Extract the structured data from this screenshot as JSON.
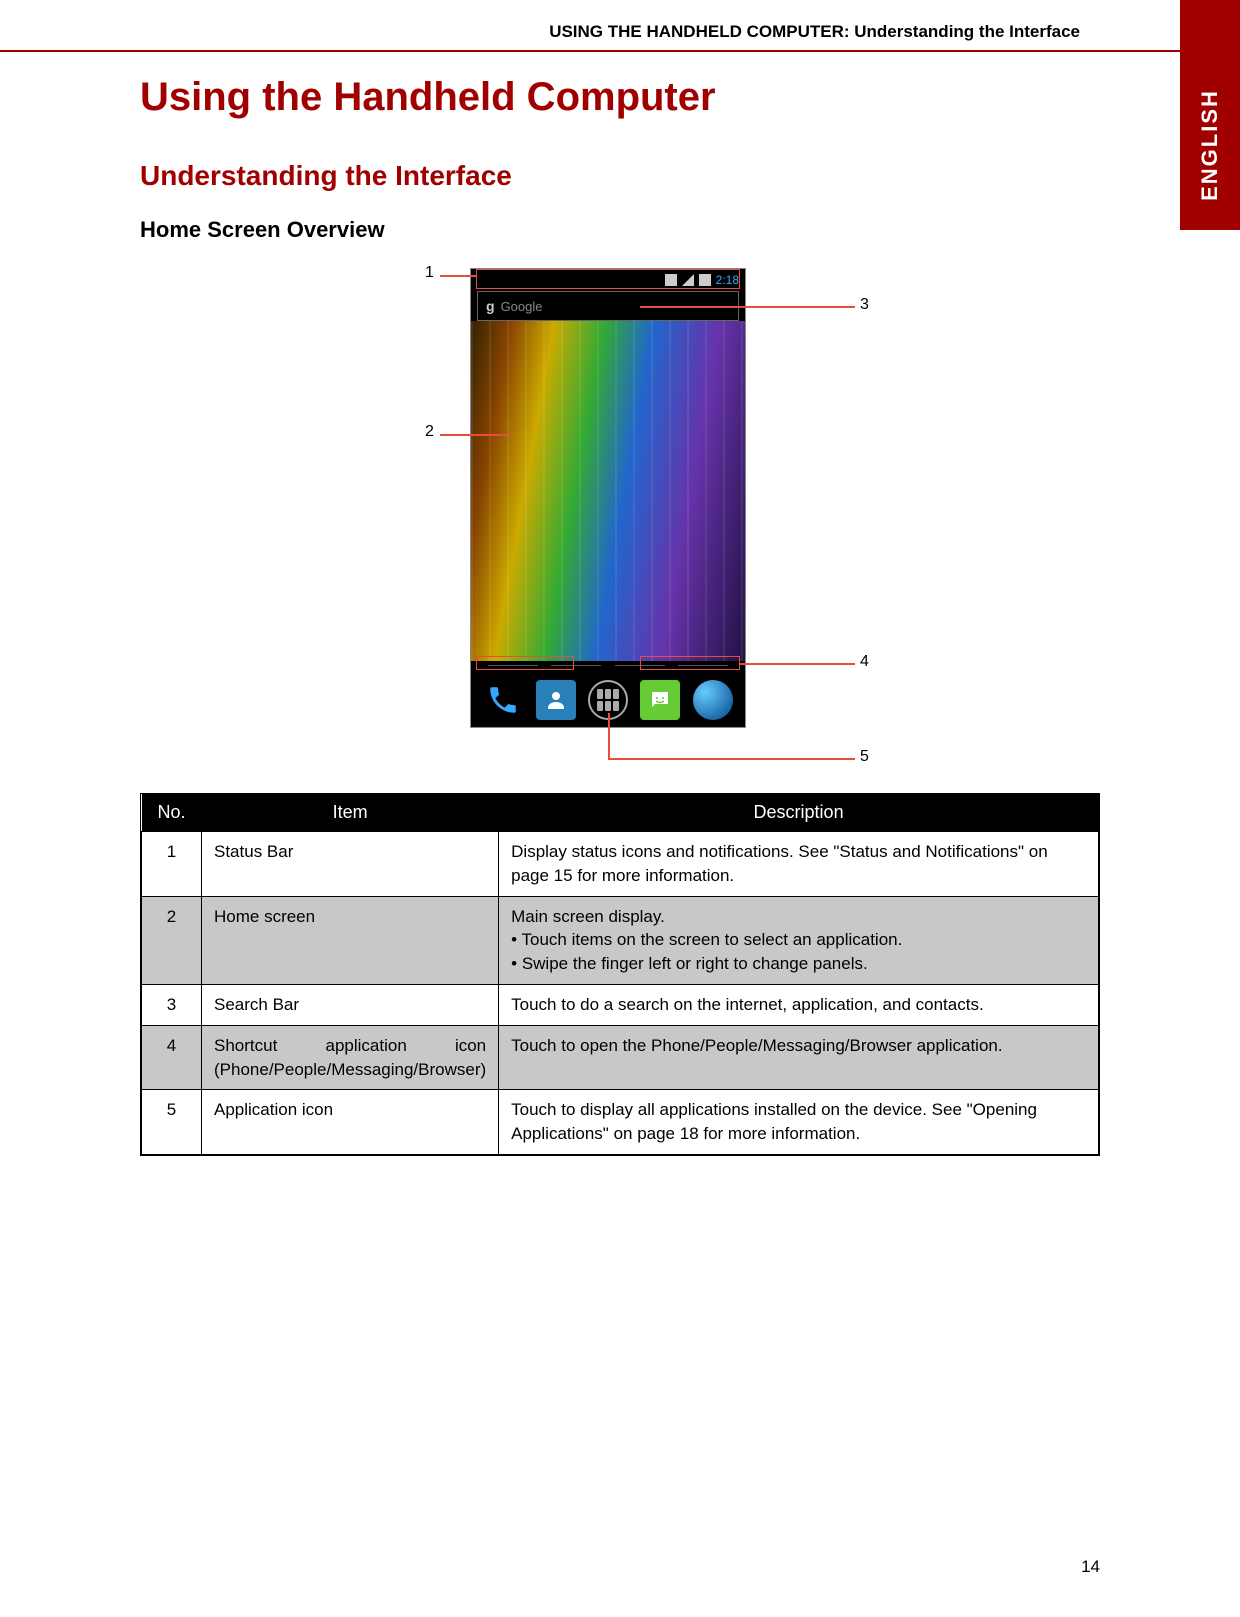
{
  "header": {
    "running_head": "USING THE HANDHELD COMPUTER: Understanding the Interface",
    "language_tab": "ENGLISH"
  },
  "titles": {
    "main": "Using the Handheld Computer",
    "section": "Understanding the Interface",
    "subsection": "Home Screen Overview"
  },
  "phone": {
    "time": "2:18",
    "search_logo": "g",
    "search_placeholder": "Google"
  },
  "callouts": {
    "c1": "1",
    "c2": "2",
    "c3": "3",
    "c4": "4",
    "c5": "5"
  },
  "table": {
    "headers": {
      "no": "No.",
      "item": "Item",
      "desc": "Description"
    },
    "rows": [
      {
        "no": "1",
        "item": "Status Bar",
        "desc": "Display status icons and notifications. See \"Status and Notifications\" on page 15 for more information."
      },
      {
        "no": "2",
        "item": "Home screen",
        "desc": "Main screen display.\n• Touch items on the screen to select an application.\n• Swipe the finger left or right to change panels."
      },
      {
        "no": "3",
        "item": "Search Bar",
        "desc": "Touch to do a search on the internet, application, and contacts."
      },
      {
        "no": "4",
        "item": "Shortcut application icon (Phone/People/Messaging/Browser)",
        "desc": "Touch to open the Phone/People/Messaging/Browser application."
      },
      {
        "no": "5",
        "item": "Application icon",
        "desc": "Touch to display all applications installed on the device. See \"Opening Applications\" on page 18 for more information."
      }
    ]
  },
  "page_number": "14"
}
